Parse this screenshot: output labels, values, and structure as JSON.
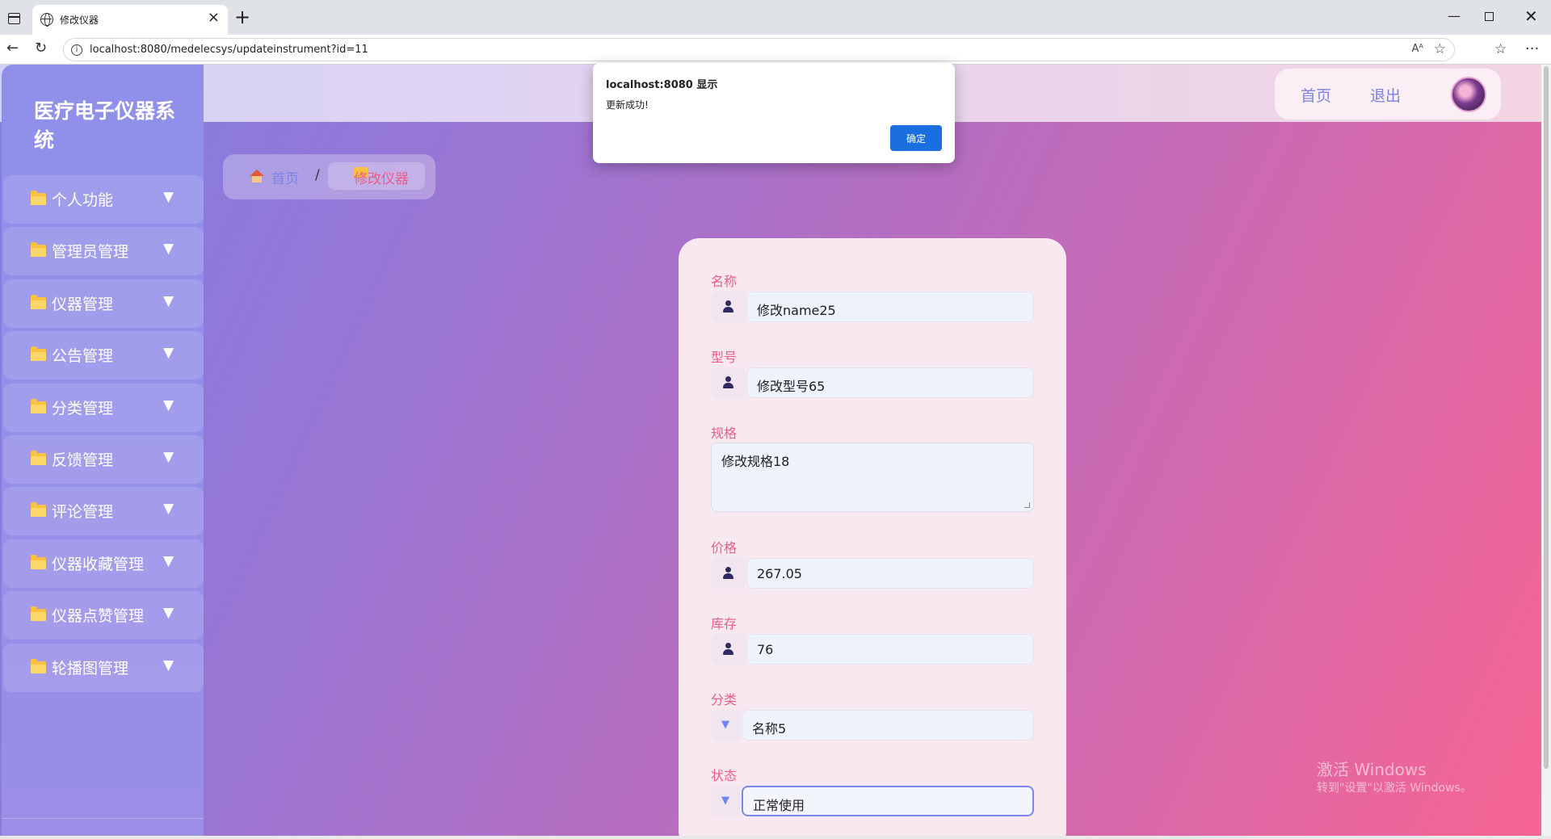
{
  "browser": {
    "tab_title": "修改仪器",
    "url": "localhost:8080/medelecsys/updateinstrument?id=11",
    "read_aloud": "Aᴬ"
  },
  "header": {
    "nav_home": "首页",
    "nav_logout": "退出"
  },
  "sidebar": {
    "brand": "医疗电子仪器系统",
    "items": [
      {
        "label": "个人功能"
      },
      {
        "label": "管理员管理"
      },
      {
        "label": "仪器管理"
      },
      {
        "label": "公告管理"
      },
      {
        "label": "分类管理"
      },
      {
        "label": "反馈管理"
      },
      {
        "label": "评论管理"
      },
      {
        "label": "仪器收藏管理"
      },
      {
        "label": "仪器点赞管理"
      },
      {
        "label": "轮播图管理"
      }
    ],
    "caret": "▼"
  },
  "breadcrumb": {
    "home": "首页",
    "separator": "/",
    "current": "修改仪器"
  },
  "form": {
    "name_label": "名称",
    "name_value": "修改name25",
    "model_label": "型号",
    "model_value": "修改型号65",
    "spec_label": "规格",
    "spec_value": "修改规格18",
    "price_label": "价格",
    "price_value": "267.05",
    "stock_label": "库存",
    "stock_value": "76",
    "category_label": "分类",
    "category_value": "名称5",
    "status_label": "状态",
    "status_value": "正常使用"
  },
  "dialog": {
    "title": "localhost:8080 显示",
    "message": "更新成功!",
    "ok_label": "确定"
  },
  "watermark": {
    "title": "激活 Windows",
    "subtitle": "转到\"设置\"以激活 Windows。"
  },
  "colors": {
    "accent": "#7c82e6",
    "label_pink": "#ee5c86",
    "dialog_button": "#1a6ee0"
  }
}
